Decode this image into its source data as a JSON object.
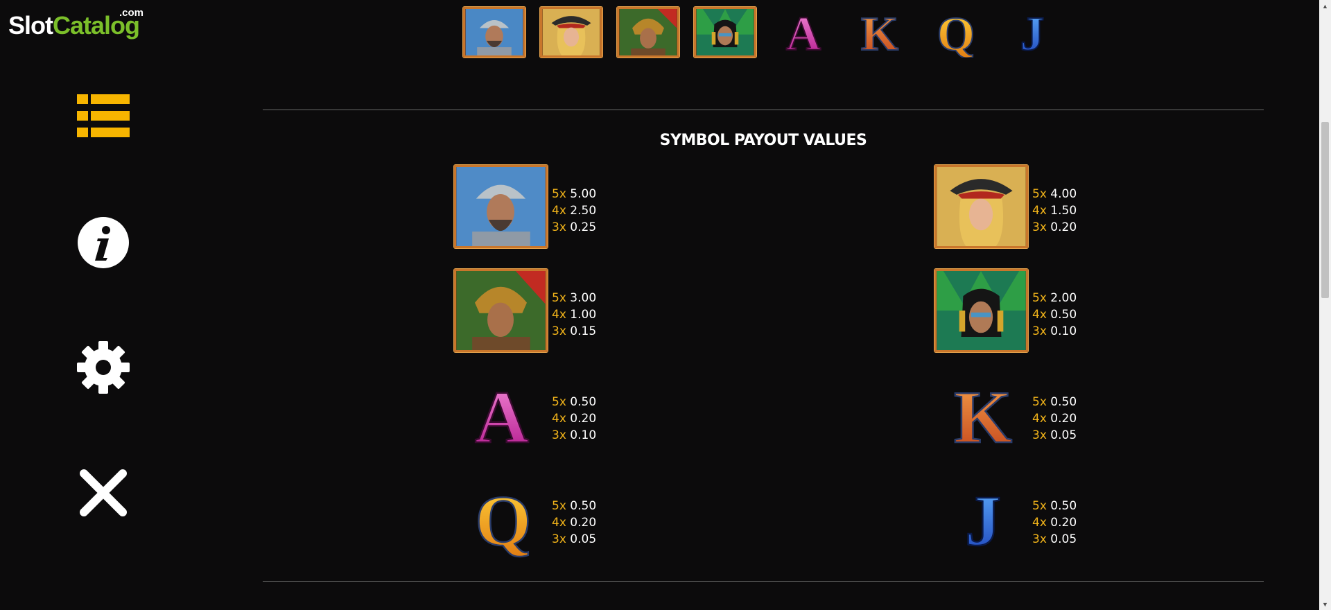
{
  "logo": {
    "slot": "Slot",
    "catalog": "Catalog",
    "com": ".com"
  },
  "sidebar": [
    {
      "name": "menu-list-icon",
      "color": "#f7b500"
    },
    {
      "name": "info-icon",
      "color": "#ffffff"
    },
    {
      "name": "gear-icon",
      "color": "#ffffff"
    },
    {
      "name": "close-icon",
      "color": "#ffffff"
    }
  ],
  "top_strip": [
    {
      "symbol": "conquistador"
    },
    {
      "symbol": "pirate-woman"
    },
    {
      "symbol": "aztec-warrior"
    },
    {
      "symbol": "aztec-woman"
    },
    {
      "symbol": "A"
    },
    {
      "symbol": "K"
    },
    {
      "symbol": "Q"
    },
    {
      "symbol": "J"
    }
  ],
  "section_title": "SYMBOL PAYOUT VALUES",
  "payouts": [
    {
      "symbol": "conquistador",
      "rows": [
        {
          "mult": "5x",
          "value": "5.00"
        },
        {
          "mult": "4x",
          "value": "2.50"
        },
        {
          "mult": "3x",
          "value": "0.25"
        }
      ]
    },
    {
      "symbol": "pirate-woman",
      "rows": [
        {
          "mult": "5x",
          "value": "4.00"
        },
        {
          "mult": "4x",
          "value": "1.50"
        },
        {
          "mult": "3x",
          "value": "0.20"
        }
      ]
    },
    {
      "symbol": "aztec-warrior",
      "rows": [
        {
          "mult": "5x",
          "value": "3.00"
        },
        {
          "mult": "4x",
          "value": "1.00"
        },
        {
          "mult": "3x",
          "value": "0.15"
        }
      ]
    },
    {
      "symbol": "aztec-woman",
      "rows": [
        {
          "mult": "5x",
          "value": "2.00"
        },
        {
          "mult": "4x",
          "value": "0.50"
        },
        {
          "mult": "3x",
          "value": "0.10"
        }
      ]
    },
    {
      "symbol": "A",
      "rows": [
        {
          "mult": "5x",
          "value": "0.50"
        },
        {
          "mult": "4x",
          "value": "0.20"
        },
        {
          "mult": "3x",
          "value": "0.10"
        }
      ]
    },
    {
      "symbol": "K",
      "rows": [
        {
          "mult": "5x",
          "value": "0.50"
        },
        {
          "mult": "4x",
          "value": "0.20"
        },
        {
          "mult": "3x",
          "value": "0.05"
        }
      ]
    },
    {
      "symbol": "Q",
      "rows": [
        {
          "mult": "5x",
          "value": "0.50"
        },
        {
          "mult": "4x",
          "value": "0.20"
        },
        {
          "mult": "3x",
          "value": "0.05"
        }
      ]
    },
    {
      "symbol": "J",
      "rows": [
        {
          "mult": "5x",
          "value": "0.50"
        },
        {
          "mult": "4x",
          "value": "0.20"
        },
        {
          "mult": "3x",
          "value": "0.05"
        }
      ]
    }
  ],
  "colors": {
    "multiplier": "#f2b41a",
    "value": "#ffffff",
    "accent": "#f7b500",
    "background": "#0c0b0c"
  }
}
